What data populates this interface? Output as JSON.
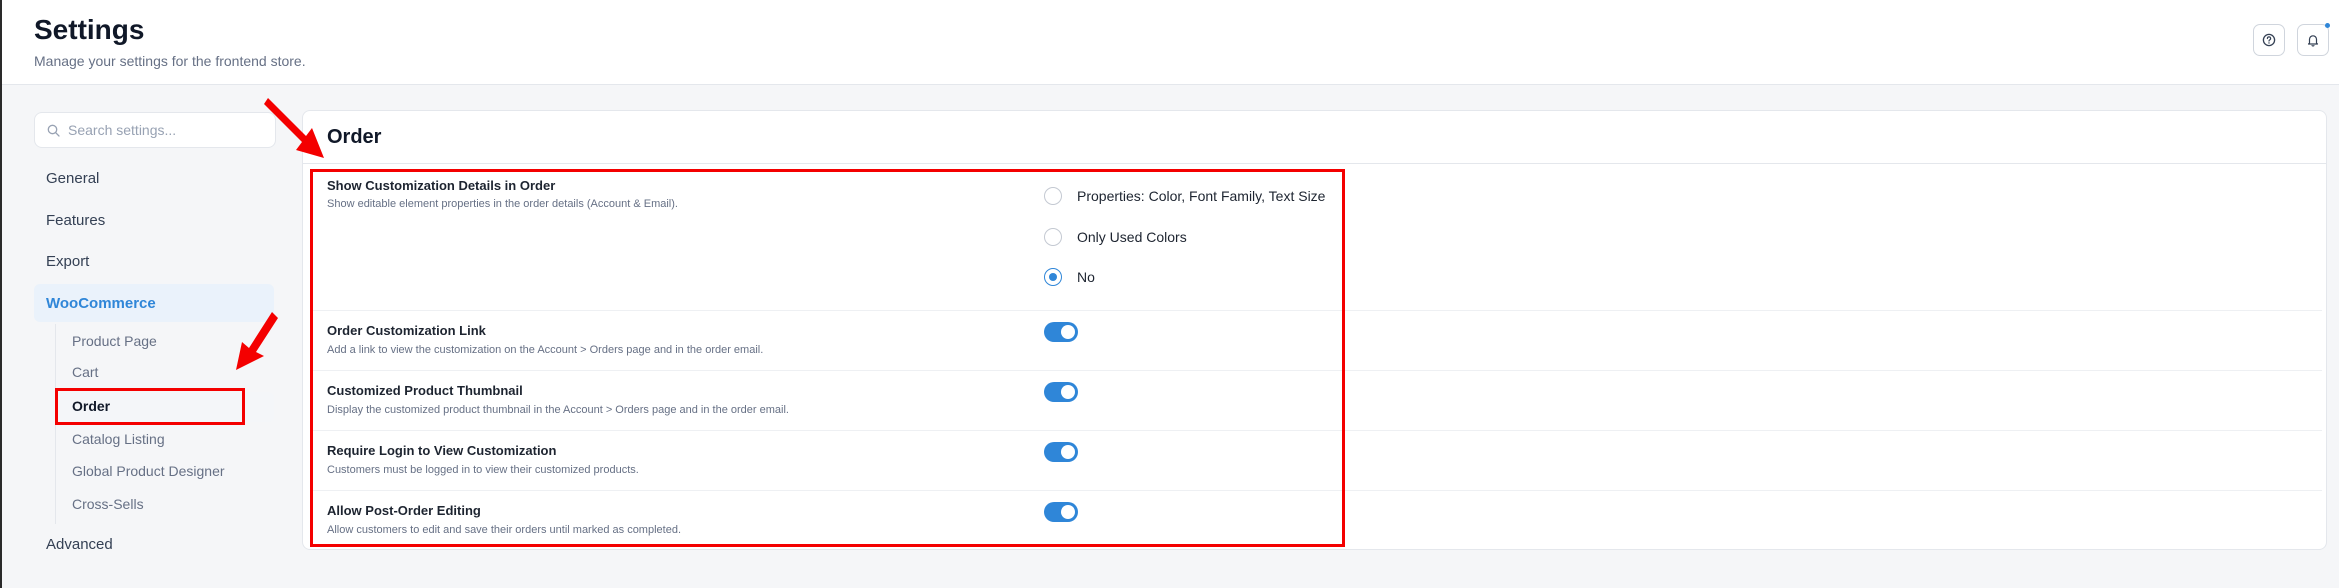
{
  "header": {
    "title": "Settings",
    "subtitle": "Manage your settings for the frontend store."
  },
  "sidebar": {
    "search_placeholder": "Search settings...",
    "items": [
      {
        "label": "General"
      },
      {
        "label": "Features"
      },
      {
        "label": "Export"
      },
      {
        "label": "WooCommerce"
      },
      {
        "label": "Advanced"
      }
    ],
    "woocommerce_subitems": [
      {
        "label": "Product Page"
      },
      {
        "label": "Cart"
      },
      {
        "label": "Order"
      },
      {
        "label": "Catalog Listing"
      },
      {
        "label": "Global Product Designer"
      },
      {
        "label": "Cross-Sells"
      }
    ],
    "active_subitem": "Order"
  },
  "main": {
    "section_title": "Order",
    "settings": [
      {
        "title": "Show Customization Details in Order",
        "description": "Show editable element properties in the order details (Account & Email).",
        "type": "radio",
        "options": [
          {
            "label": "Properties: Color, Font Family, Text Size",
            "checked": false
          },
          {
            "label": "Only Used Colors",
            "checked": false
          },
          {
            "label": "No",
            "checked": true
          }
        ]
      },
      {
        "title": "Order Customization Link",
        "description": "Add a link to view the customization on the Account > Orders page and in the order email.",
        "type": "toggle",
        "enabled": true
      },
      {
        "title": "Customized Product Thumbnail",
        "description": "Display the customized product thumbnail in the Account > Orders page and in the order email.",
        "type": "toggle",
        "enabled": true
      },
      {
        "title": "Require Login to View Customization",
        "description": "Customers must be logged in to view their customized products.",
        "type": "toggle",
        "enabled": true
      },
      {
        "title": "Allow Post-Order Editing",
        "description": "Allow customers to edit and save their orders until marked as completed.",
        "type": "toggle",
        "enabled": true
      }
    ]
  },
  "colors": {
    "accent": "#2f86d8",
    "annotation": "#f40000"
  },
  "icons": {
    "help": "help-circle-icon",
    "notifications": "bell-icon",
    "search": "search-icon"
  }
}
